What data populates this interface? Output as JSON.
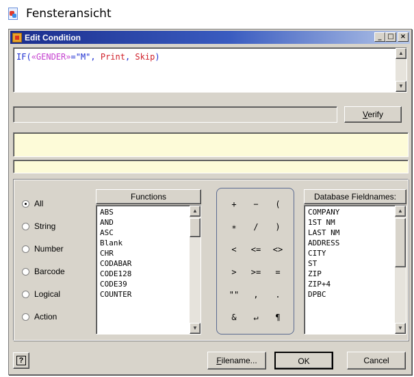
{
  "page_header": {
    "text": "Fensteransicht",
    "icon": "document-icon"
  },
  "dialog": {
    "title": "Edit Condition",
    "title_buttons": [
      "_",
      "□",
      "×"
    ]
  },
  "expression": {
    "tokens": [
      {
        "text": "IF(",
        "kind": "fn"
      },
      {
        "text": "«GENDER»",
        "kind": "field"
      },
      {
        "text": "=\"M\"",
        "kind": "str"
      },
      {
        "text": ", ",
        "kind": "punc"
      },
      {
        "text": "Print",
        "kind": "kw"
      },
      {
        "text": ", ",
        "kind": "punc"
      },
      {
        "text": "Skip",
        "kind": "kw"
      },
      {
        "text": ")",
        "kind": "punc"
      }
    ]
  },
  "verify_button": {
    "label_pre": "",
    "label_ul": "V",
    "label_post": "erify"
  },
  "filter": {
    "options": [
      "All",
      "String",
      "Number",
      "Barcode",
      "Logical",
      "Action"
    ],
    "selected": "All"
  },
  "functions": {
    "header": "Functions",
    "items": [
      "ABS",
      "AND",
      "ASC",
      "Blank",
      "CHR",
      "CODABAR",
      "CODE128",
      "CODE39",
      "COUNTER"
    ]
  },
  "operators": {
    "rows": [
      [
        "+",
        "−",
        "("
      ],
      [
        "∗",
        "/",
        ")"
      ],
      [
        "<",
        "<=",
        "<>"
      ],
      [
        ">",
        ">=",
        "="
      ],
      [
        "\"\"",
        ",",
        "."
      ],
      [
        "&",
        "↵",
        "¶"
      ]
    ]
  },
  "fieldnames": {
    "header": "Database Fieldnames:",
    "items": [
      "COMPANY",
      "1ST NM",
      "LAST NM",
      "ADDRESS",
      "CITY",
      "ST",
      "ZIP",
      "ZIP+4",
      "DPBC"
    ]
  },
  "buttons": {
    "help": "?",
    "filename_ul": "F",
    "filename_rest": "ilename...",
    "ok": "OK",
    "cancel": "Cancel"
  }
}
